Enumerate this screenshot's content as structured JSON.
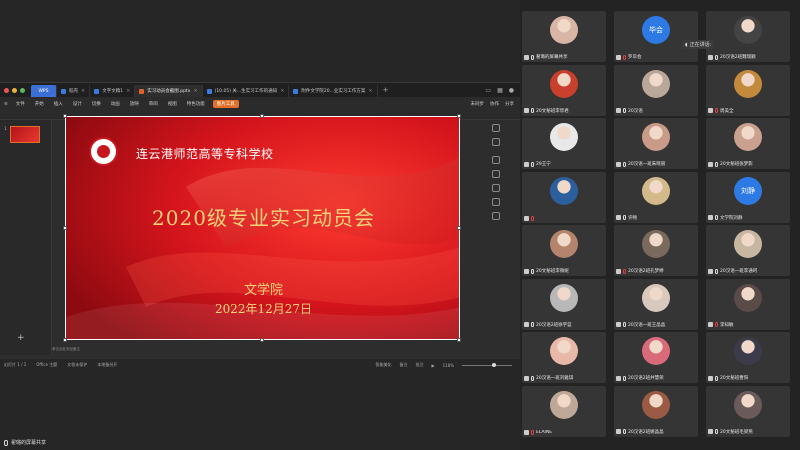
{
  "wps": {
    "tabs": [
      {
        "label": "WPS",
        "icon": "wps-logo-icon",
        "type": "wps"
      },
      {
        "label": "稻壳",
        "icon": "docer-icon",
        "type": ""
      },
      {
        "label": "文字文稿1",
        "icon": "word-icon",
        "type": ""
      },
      {
        "label": "实习动员会截图.pptx",
        "icon": "ppt-icon",
        "type": "active"
      },
      {
        "label": "(10.05) 关...生实习工作的通知",
        "icon": "word-icon",
        "type": ""
      },
      {
        "label": "附件文学院20...业实习工作方案",
        "icon": "word-icon",
        "type": ""
      }
    ],
    "menu": [
      "文件",
      "开始",
      "插入",
      "设计",
      "切换",
      "动画",
      "放映",
      "审阅",
      "视图",
      "特色功能"
    ],
    "menu_highlight": "图片工具",
    "menu_right": [
      "未同步",
      "协作",
      "分享"
    ],
    "slide_number": "1",
    "notes_placeholder": "单击此处添加备注",
    "status_left": [
      "幻灯片 1 / 1",
      "Office 主题",
      "文档未保护",
      "本地备份开"
    ],
    "status_right": [
      "智能美化",
      "备注",
      "批注"
    ],
    "zoom": "118%"
  },
  "slide": {
    "school": "连云港师范高等专科学校",
    "headline": "2020级专业实习动员会",
    "department": "文学院",
    "date": "2022年12月27日"
  },
  "sharer": "翟璐的屏幕共享",
  "speaking": "正在讲话:",
  "participants": [
    {
      "name": "翟璐的屏幕共享",
      "avatar": "#d8b5a5",
      "kind": "photo"
    },
    {
      "name": "罗毕会",
      "avatar": "#2d7ae5",
      "kind": "text",
      "text": "毕会"
    },
    {
      "name": "20汉语2班魏瑞颖",
      "avatar": "#444",
      "kind": "photo"
    },
    {
      "name": "20文秘班李欣君",
      "avatar": "#c9402c",
      "kind": "photo"
    },
    {
      "name": "20汉语",
      "avatar": "#b9a89a",
      "kind": "photo"
    },
    {
      "name": "周美全",
      "avatar": "#c28a3a",
      "kind": "photo"
    },
    {
      "name": "29王宁",
      "avatar": "#e8e8e8",
      "kind": "photo"
    },
    {
      "name": "20汉语一班朱晓丽",
      "avatar": "#c99a88",
      "kind": "photo"
    },
    {
      "name": "20文秘班张梦影",
      "avatar": "#caa08f",
      "kind": "photo"
    },
    {
      "name": "",
      "avatar": "#2c5f9e",
      "kind": "photo"
    },
    {
      "name": "许畅",
      "avatar": "#d4b98a",
      "kind": "photo"
    },
    {
      "name": "文学院刘静",
      "avatar": "#2d7ae5",
      "kind": "text",
      "text": "刘静"
    },
    {
      "name": "20文秘班李微妮",
      "avatar": "#b4846c",
      "kind": "photo"
    },
    {
      "name": "20汉语2班孔梦婷",
      "avatar": "#7a6a5e",
      "kind": "photo"
    },
    {
      "name": "20汉语一班李通珂",
      "avatar": "#c8b7a0",
      "kind": "photo"
    },
    {
      "name": "20汉语2班徐宇蓝",
      "avatar": "#b8b8b8",
      "kind": "photo"
    },
    {
      "name": "20汉语一班王晶晶",
      "avatar": "#d9c8be",
      "kind": "photo"
    },
    {
      "name": "李知敏",
      "avatar": "#5a4a48",
      "kind": "photo"
    },
    {
      "name": "20汉语一班刘雅琪",
      "avatar": "#e8b8a8",
      "kind": "photo"
    },
    {
      "name": "20汉语2班井慧荣",
      "avatar": "#d86a7a",
      "kind": "photo"
    },
    {
      "name": "20文秘班曹阳",
      "avatar": "#3b3b4a",
      "kind": "photo"
    },
    {
      "name": "ELAINE",
      "avatar": "#c0a898",
      "kind": "photo"
    },
    {
      "name": "20汉语2班姚晶晶",
      "avatar": "#9a5a44",
      "kind": "photo"
    },
    {
      "name": "20文秘班毛梁燕",
      "avatar": "#6a5a5a",
      "kind": "photo"
    }
  ],
  "colors": {
    "slide_red": "#c8141c",
    "accent_orange": "#e2702a",
    "gold_text": "#f4d27a"
  }
}
